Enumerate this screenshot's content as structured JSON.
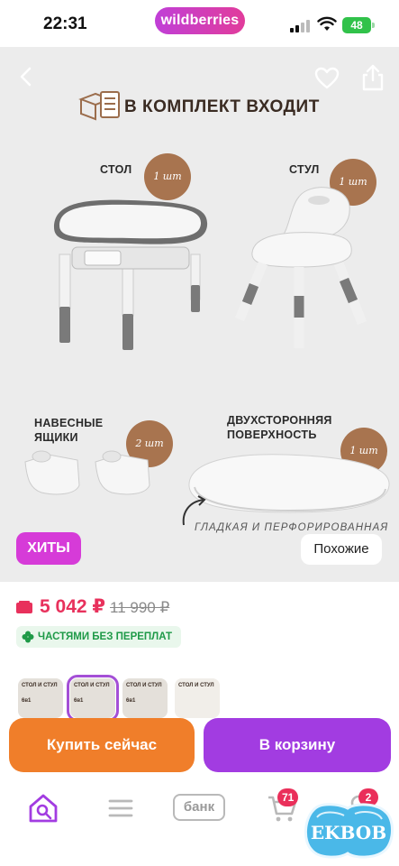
{
  "status_bar": {
    "time": "22:31",
    "app_brand": "wildberries",
    "battery": "48"
  },
  "product": {
    "kit_title": "В КОМПЛЕКТ ВХОДИТ",
    "items": [
      {
        "label": "СТОЛ",
        "qty": "1 шт"
      },
      {
        "label": "СТУЛ",
        "qty": "1 шт"
      },
      {
        "label": "НАВЕСНЫЕ ЯЩИКИ",
        "qty": "2 шт"
      },
      {
        "label": "ДВУХСТОРОННЯЯ ПОВЕРХНОСТЬ",
        "qty": "1 шт"
      }
    ],
    "caption": "ГЛАДКАЯ И ПЕРФОРИРОВАННАЯ",
    "hits_label": "ХИТЫ",
    "similar_label": "Похожие"
  },
  "price": {
    "current": "5 042 ₽",
    "old": "11 990 ₽",
    "installment": "ЧАСТЯМИ БЕЗ ПЕРЕПЛАТ",
    "accent_color": "#e8315c"
  },
  "thumbnails": [
    {
      "text": "СТОЛ И СТУЛ",
      "sub": "6в1"
    },
    {
      "text": "СТОЛ И СТУЛ",
      "sub": "6в1"
    },
    {
      "text": "СТОЛ И СТУЛ",
      "sub": "6в1"
    },
    {
      "text": "СТОЛ И СТУЛ",
      "sub": ""
    }
  ],
  "actions": {
    "buy_now": "Купить сейчас",
    "add_to_cart": "В корзину",
    "buy_color": "#f07e2a",
    "cart_color": "#a23ce1"
  },
  "tabbar": {
    "items": [
      {
        "icon": "home-search-icon"
      },
      {
        "icon": "catalog-menu-icon"
      },
      {
        "icon": "bank-icon",
        "label": "банк"
      },
      {
        "icon": "cart-icon",
        "badge": "71"
      },
      {
        "icon": "profile-icon",
        "badge": "2"
      }
    ]
  },
  "watermark": "EKBOB"
}
